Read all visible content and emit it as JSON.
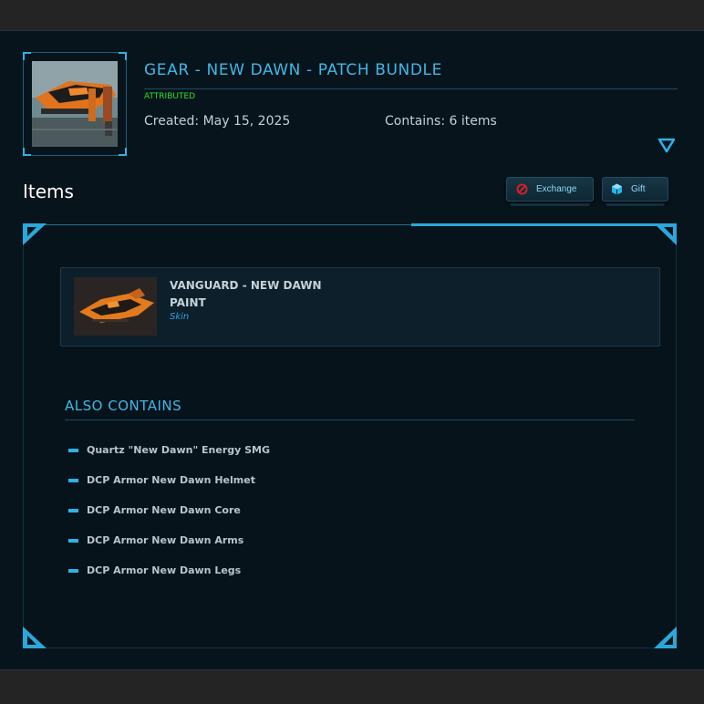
{
  "bundle": {
    "title": "GEAR - NEW DAWN - PATCH BUNDLE",
    "status": "ATTRIBUTED",
    "created": "Created: May 15, 2025",
    "contains": "Contains: 6 items"
  },
  "section": {
    "heading": "Items"
  },
  "actions": {
    "exchange_label": "Exchange",
    "gift_label": "Gift"
  },
  "item": {
    "name": "VANGUARD - NEW DAWN PAINT",
    "type": "Skin"
  },
  "also_contains": {
    "heading": "ALSO CONTAINS",
    "items": [
      "Quartz \"New Dawn\" Energy SMG",
      "DCP Armor New Dawn Helmet",
      "DCP Armor New Dawn Core",
      "DCP Armor New Dawn Arms",
      "DCP Armor New Dawn Legs"
    ]
  },
  "colors": {
    "accent": "#3fb8e6",
    "status_green": "#2ee02e",
    "background": "#08141c",
    "exchange_icon": "#d21f26"
  },
  "icons": [
    "expand-chevron-icon",
    "exchange-icon",
    "gift-icon",
    "list-bullet-icon"
  ]
}
